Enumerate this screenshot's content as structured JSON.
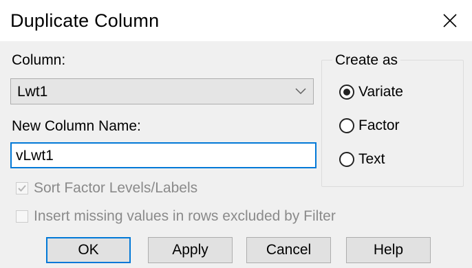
{
  "window": {
    "title": "Duplicate Column",
    "close_icon": "close-icon"
  },
  "column": {
    "label": "Column:",
    "selected": "Lwt1"
  },
  "new_name": {
    "label": "New Column Name:",
    "value": "vLwt1"
  },
  "options": {
    "sort_levels": {
      "label": "Sort Factor Levels/Labels",
      "checked": true,
      "enabled": false
    },
    "insert_missing": {
      "label": "Insert missing values in rows excluded by Filter",
      "checked": false,
      "enabled": false
    }
  },
  "create_as": {
    "title": "Create as",
    "options": [
      {
        "label": "Variate",
        "selected": true
      },
      {
        "label": "Factor",
        "selected": false
      },
      {
        "label": "Text",
        "selected": false
      }
    ]
  },
  "buttons": {
    "ok": "OK",
    "apply": "Apply",
    "cancel": "Cancel",
    "help": "Help"
  },
  "colors": {
    "accent": "#0078d7",
    "dialog_bg": "#f0f0f0",
    "disabled_text": "#8a8a8a"
  }
}
